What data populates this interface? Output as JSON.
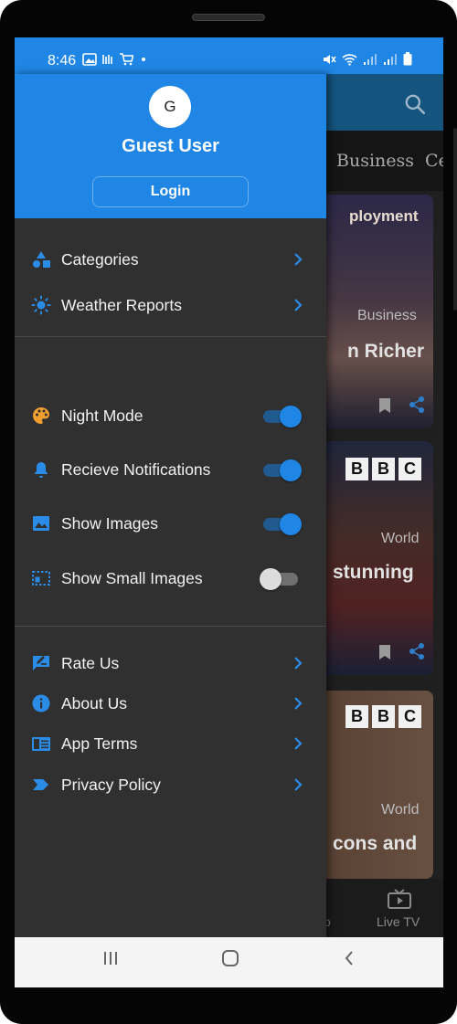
{
  "status_bar": {
    "time": "8:46",
    "left_icons": [
      "gallery-icon",
      "app-icon",
      "cart-icon",
      "dot"
    ],
    "right_icons": [
      "mute-icon",
      "wifi-icon",
      "signal-icon",
      "signal-icon",
      "battery-icon"
    ]
  },
  "drawer": {
    "avatar_letter": "G",
    "user_name": "Guest User",
    "login_label": "Login",
    "nav_items": [
      {
        "label": "Categories",
        "icon": "shapes-icon"
      },
      {
        "label": "Weather Reports",
        "icon": "sun-icon"
      }
    ],
    "settings": [
      {
        "label": "Night Mode",
        "icon": "palette-icon",
        "enabled": true
      },
      {
        "label": "Recieve Notifications",
        "icon": "bell-icon",
        "enabled": true
      },
      {
        "label": "Show Images",
        "icon": "image-icon",
        "enabled": true
      },
      {
        "label": "Show Small Images",
        "icon": "dashed-image-icon",
        "enabled": false
      }
    ],
    "info_items": [
      {
        "label": "Rate Us",
        "icon": "rate-icon"
      },
      {
        "label": "About Us",
        "icon": "info-icon"
      },
      {
        "label": "App Terms",
        "icon": "terms-icon"
      },
      {
        "label": "Privacy Policy",
        "icon": "policy-icon"
      }
    ]
  },
  "background": {
    "categories": [
      "Business",
      "Ce"
    ],
    "cards": [
      {
        "top_text": "ployment",
        "tag": "Business",
        "title": "n Richer"
      },
      {
        "logo": [
          "B",
          "B",
          "C"
        ],
        "tag": "World",
        "title": "stunning"
      },
      {
        "logo": [
          "B",
          "B",
          "C"
        ],
        "tag": "World",
        "title": "cons and"
      }
    ],
    "bottom_nav": {
      "live_tv_label": "Live TV",
      "partial_label": "o"
    }
  },
  "colors": {
    "accent": "#1f86e5",
    "drawer_bg": "#303030",
    "icon_orange": "#f0a030"
  }
}
